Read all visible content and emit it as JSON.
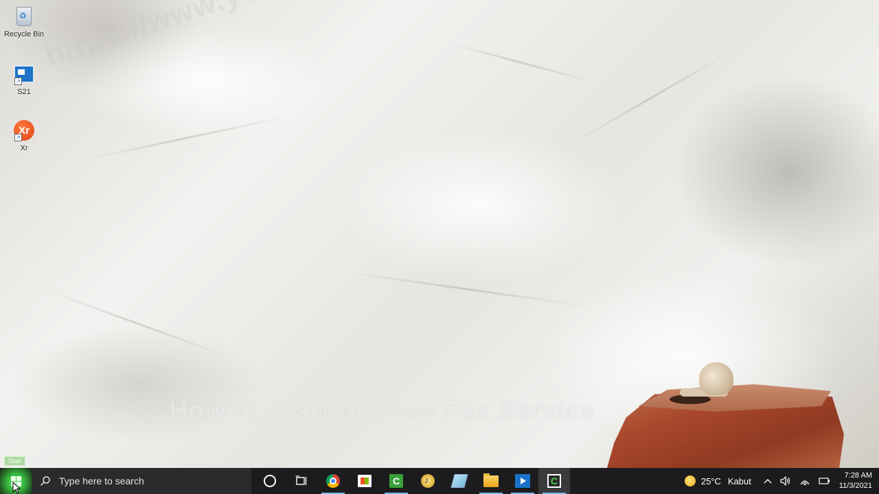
{
  "desktop": {
    "icons": [
      {
        "label": "Recycle Bin",
        "icon": "recycle-bin-icon"
      },
      {
        "label": "S21",
        "icon": "s21-app-icon"
      },
      {
        "label": "Xr",
        "icon": "xr-app-icon"
      }
    ],
    "watermark_url": "https://www.youtube.com",
    "video_title": "How to Start or Stop Fax Service",
    "start_tooltip": "Start"
  },
  "taskbar": {
    "search_placeholder": "Type here to search",
    "apps": [
      {
        "name": "cortana",
        "icon": "cortana-circle-icon"
      },
      {
        "name": "task-view",
        "icon": "task-view-icon"
      },
      {
        "name": "google-chrome",
        "icon": "chrome-icon"
      },
      {
        "name": "microsoft-store",
        "icon": "store-icon"
      },
      {
        "name": "camtasia",
        "icon": "camtasia-icon"
      },
      {
        "name": "audio-app",
        "icon": "audio-icon"
      },
      {
        "name": "notes-app",
        "icon": "notes-icon"
      },
      {
        "name": "file-explorer",
        "icon": "folder-icon"
      },
      {
        "name": "media-player",
        "icon": "media-player-icon"
      },
      {
        "name": "camtasia-recorder",
        "icon": "camtasia-recorder-icon"
      }
    ],
    "weather": {
      "temp": "25°C",
      "condition": "Kabut"
    },
    "clock": {
      "time": "7:28 AM",
      "date": "11/3/2021"
    }
  },
  "colors": {
    "taskbar_bg": "#1c1c1e",
    "start_highlight": "#38b840",
    "active_indicator": "#76b9ed"
  }
}
